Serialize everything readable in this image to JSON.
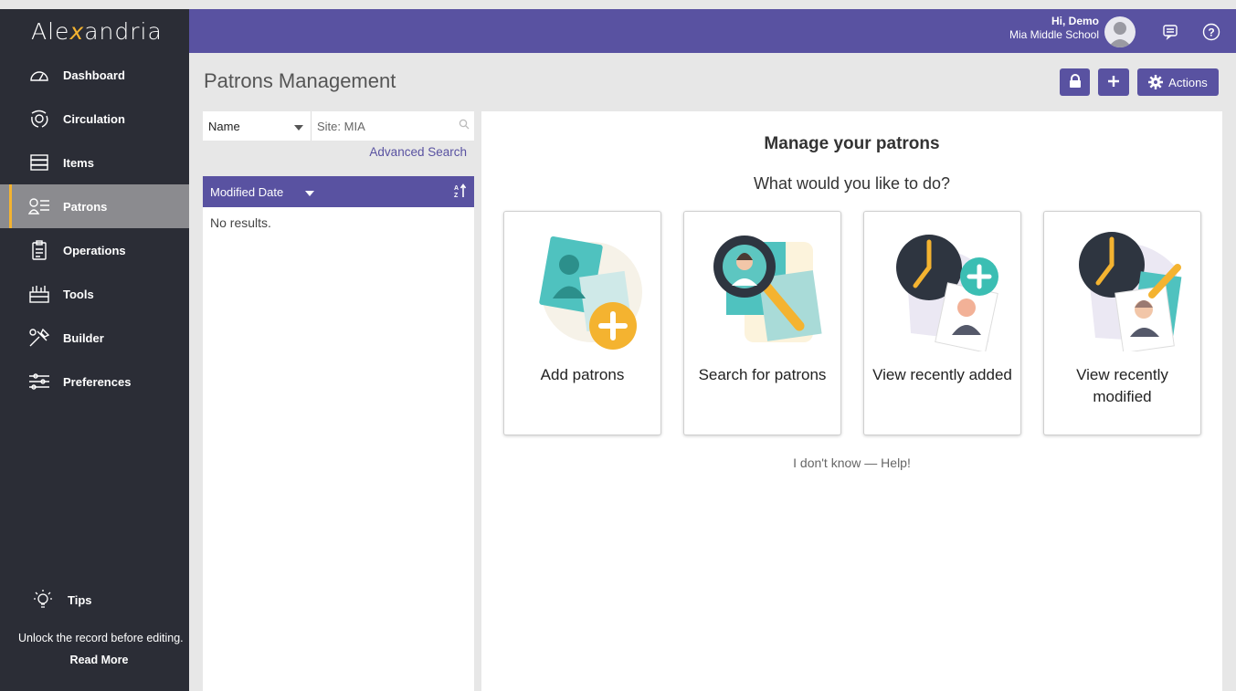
{
  "app": {
    "logo_pre": "Ale",
    "logo_accent": "x",
    "logo_post": "andria"
  },
  "sidebar": {
    "items": [
      {
        "label": "Dashboard",
        "icon": "speedometer-icon"
      },
      {
        "label": "Circulation",
        "icon": "circulation-icon"
      },
      {
        "label": "Items",
        "icon": "books-icon"
      },
      {
        "label": "Patrons",
        "icon": "patrons-icon",
        "active": true
      },
      {
        "label": "Operations",
        "icon": "clipboard-icon"
      },
      {
        "label": "Tools",
        "icon": "toolbox-icon"
      },
      {
        "label": "Builder",
        "icon": "builder-icon"
      },
      {
        "label": "Preferences",
        "icon": "sliders-icon"
      }
    ],
    "tips": {
      "title": "Tips",
      "text": "Unlock the record before editing.",
      "read_more": "Read More"
    }
  },
  "header": {
    "greeting": "Hi, Demo",
    "school": "Mia Middle School",
    "accent_color": "#5952a1"
  },
  "page": {
    "title": "Patrons Management",
    "actions_label": "Actions"
  },
  "search": {
    "field_select": "Name",
    "site_placeholder": "Site: MIA",
    "advanced": "Advanced Search",
    "sort_label": "Modified Date",
    "no_results": "No results."
  },
  "main": {
    "heading": "Manage your patrons",
    "subheading": "What would you like to do?",
    "cards": [
      {
        "label": "Add patrons"
      },
      {
        "label": "Search for patrons"
      },
      {
        "label": "View recently added"
      },
      {
        "label": "View recently modified"
      }
    ],
    "help": "I don't know — Help!"
  }
}
